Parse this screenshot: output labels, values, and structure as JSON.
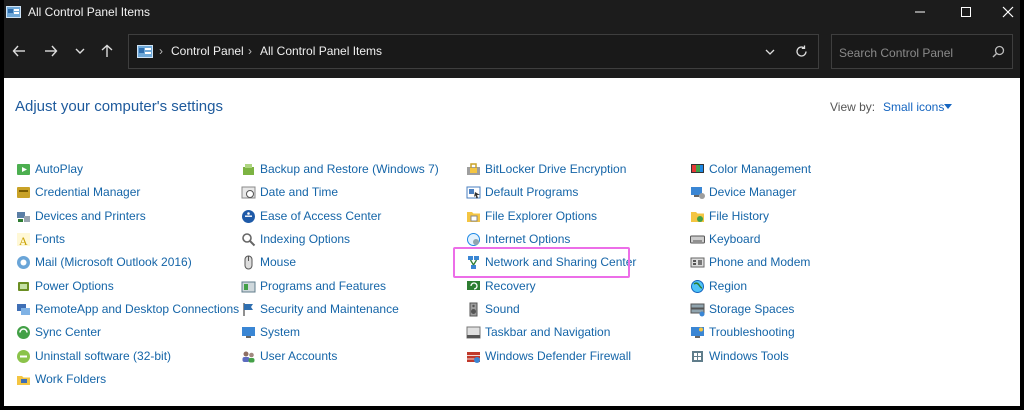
{
  "window": {
    "title": "All Control Panel Items",
    "controls": [
      "minimize-icon",
      "maximize-icon",
      "close-icon"
    ]
  },
  "navigation": {
    "buttons": [
      "back-icon",
      "forward-icon",
      "recent-dropdown-icon",
      "up-icon"
    ]
  },
  "address_bar": {
    "breadcrumbs": [
      "Control Panel",
      "All Control Panel Items"
    ]
  },
  "search": {
    "placeholder": "Search Control Panel"
  },
  "header": {
    "heading": "Adjust your computer's settings",
    "view_by_label": "View by:",
    "view_by_value": "Small icons"
  },
  "columns": [
    [
      "AutoPlay",
      "Credential Manager",
      "Devices and Printers",
      "Fonts",
      "Mail (Microsoft Outlook 2016)",
      "Power Options",
      "RemoteApp and Desktop Connections",
      "Sync Center",
      "Uninstall software (32-bit)",
      "Work Folders"
    ],
    [
      "Backup and Restore (Windows 7)",
      "Date and Time",
      "Ease of Access Center",
      "Indexing Options",
      "Mouse",
      "Programs and Features",
      "Security and Maintenance",
      "System",
      "User Accounts"
    ],
    [
      "BitLocker Drive Encryption",
      "Default Programs",
      "File Explorer Options",
      "Internet Options",
      "Network and Sharing Center",
      "Recovery",
      "Sound",
      "Taskbar and Navigation",
      "Windows Defender Firewall"
    ],
    [
      "Color Management",
      "Device Manager",
      "File History",
      "Keyboard",
      "Phone and Modem",
      "Region",
      "Storage Spaces",
      "Troubleshooting",
      "Windows Tools"
    ]
  ],
  "highlighted_item": "Network and Sharing Center",
  "colors": {
    "link": "#1565a8",
    "heading": "#1e5a9c",
    "highlight_border": "#ec6ee8",
    "titlebar": "#1c1c1c"
  }
}
